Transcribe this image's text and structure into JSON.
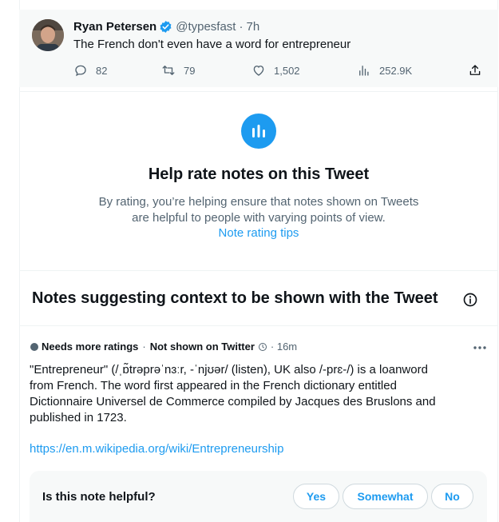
{
  "tweet": {
    "author_name": "Ryan Petersen",
    "handle": "@typesfast",
    "separator": "·",
    "time": "7h",
    "text": "The French don't even have a word for entrepreneur",
    "replies": "82",
    "retweets": "79",
    "likes": "1,502",
    "views": "252.9K"
  },
  "help": {
    "title": "Help rate notes on this Tweet",
    "description_line1": "By rating, you’re helping ensure that notes shown on Tweets",
    "description_line2": "are helpful to people with varying points of view.",
    "link": "Note rating tips"
  },
  "notes": {
    "title": "Notes suggesting context to be shown with the Tweet"
  },
  "note": {
    "status": "Needs more ratings",
    "separator": "·",
    "visibility": "Not shown on Twitter",
    "time": "· 16m",
    "body": "\"Entrepreneur\" (/ˌɒ̃trəprəˈnɜːr, -ˈnjʊər/ (listen), UK also /-prɛ-/) is a loanword from French. The word first appeared in the French dictionary entitled Dictionnaire Universel de Commerce compiled by Jacques des Bruslons and published in 1723.",
    "link": "https://en.m.wikipedia.org/wiki/Entrepreneurship"
  },
  "helpful": {
    "question": "Is this note helpful?",
    "yes": "Yes",
    "somewhat": "Somewhat",
    "no": "No"
  },
  "colors": {
    "accent": "#1d9bf0",
    "text": "#0f1419",
    "secondary": "#536471",
    "tweet_bg": "#f7f9f9"
  },
  "icons": [
    "verified-badge-icon",
    "reply-icon",
    "retweet-icon",
    "like-icon",
    "views-icon",
    "share-icon",
    "notes-bars-icon",
    "info-icon",
    "clock-icon",
    "more-icon"
  ]
}
